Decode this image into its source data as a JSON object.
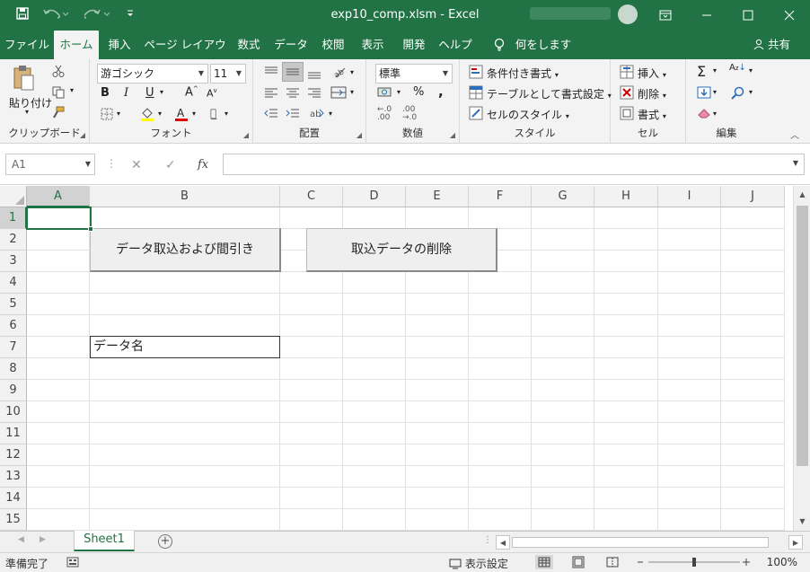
{
  "window": {
    "title": "exp10_comp.xlsm  -  Excel",
    "buttons": [
      "restore-ribbon",
      "minimize",
      "maximize",
      "close"
    ]
  },
  "tabs": [
    "ファイル",
    "ホーム",
    "挿入",
    "ページ レイアウト",
    "数式",
    "データ",
    "校閲",
    "表示",
    "開発",
    "ヘルプ",
    "何をしますか"
  ],
  "active_tab": "ホーム",
  "share_label": "共有",
  "ribbon": {
    "clipboard": {
      "paste": "貼り付け",
      "label": "クリップボード"
    },
    "font": {
      "name": "游ゴシック",
      "size": "11",
      "label": "フォント",
      "bold": "B",
      "italic": "I",
      "underline": "U"
    },
    "alignment": {
      "label": "配置"
    },
    "number": {
      "format": "標準",
      "label": "数値",
      "percent": "%",
      "comma": ","
    },
    "styles": {
      "conditional": "条件付き書式",
      "table": "テーブルとして書式設定",
      "cell": "セルのスタイル",
      "label": "スタイル"
    },
    "cells": {
      "insert": "挿入",
      "delete": "削除",
      "format": "書式",
      "label": "セル"
    },
    "editing": {
      "label": "編集",
      "sum": "Σ"
    }
  },
  "formula_bar": {
    "namebox": "A1",
    "fx": "fx",
    "value": ""
  },
  "columns": [
    "A",
    "B",
    "C",
    "D",
    "E",
    "F",
    "G",
    "H",
    "I",
    "J"
  ],
  "rows": [
    "1",
    "2",
    "3",
    "4",
    "5",
    "6",
    "7",
    "8",
    "9",
    "10",
    "11",
    "12",
    "13",
    "14",
    "15"
  ],
  "form_buttons": {
    "import": "データ取込および間引き",
    "delete": "取込データの削除"
  },
  "cell_label": "データ名",
  "sheet": {
    "name": "Sheet1"
  },
  "status": {
    "ready": "準備完了",
    "display_settings": "表示設定",
    "zoom": "100%"
  },
  "colors": {
    "brand": "#217346",
    "font_color": "#e00000",
    "highlight": "#ffff00"
  }
}
